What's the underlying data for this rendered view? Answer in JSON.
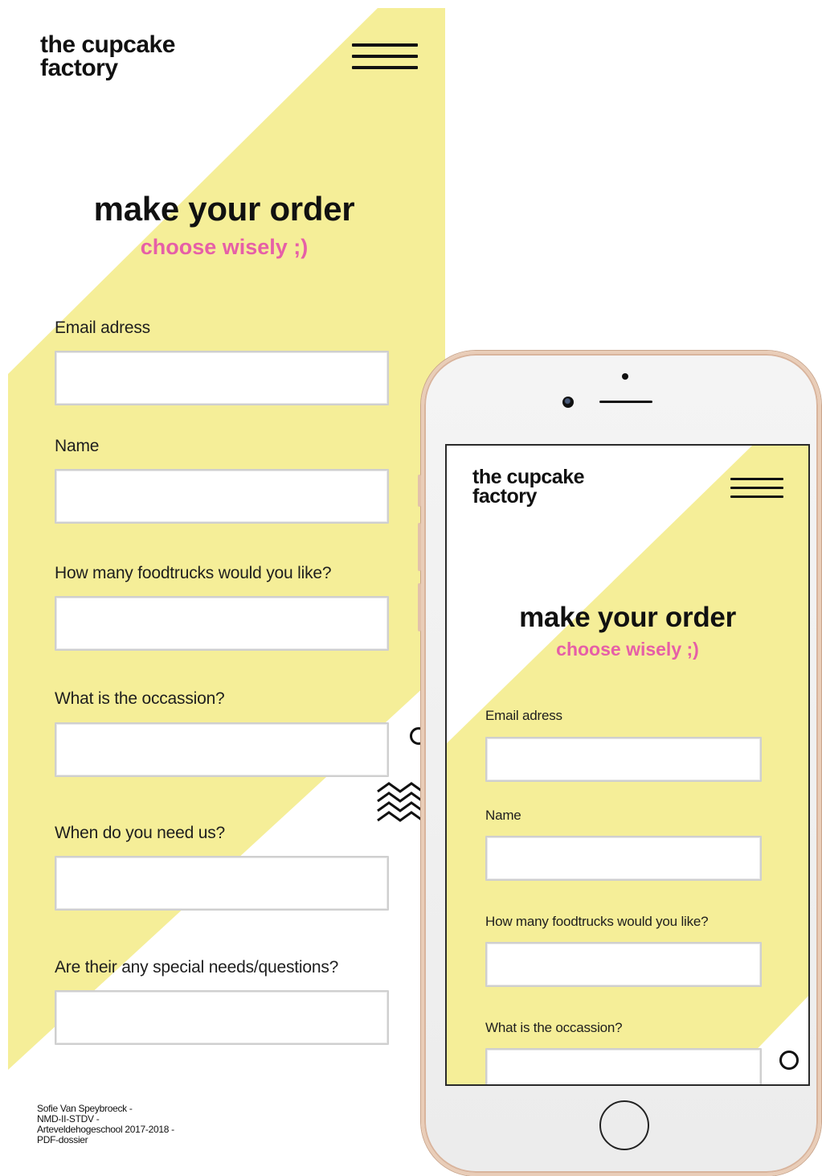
{
  "brand": {
    "line1": "the cupcake",
    "line2": "factory"
  },
  "colors": {
    "yellow": "#f5ee98",
    "pink": "#e65fa7",
    "ink": "#111111"
  },
  "page": {
    "title": "make your order",
    "subtitle": "choose wisely ;)"
  },
  "form": {
    "fields": [
      {
        "label": "Email adress",
        "value": ""
      },
      {
        "label": "Name",
        "value": ""
      },
      {
        "label": "How many foodtrucks would you like?",
        "value": ""
      },
      {
        "label": "What is the occassion?",
        "value": ""
      },
      {
        "label": "When do you need us?",
        "value": ""
      },
      {
        "label": "Are their any special needs/questions?",
        "value": ""
      }
    ]
  },
  "footer": {
    "lines": [
      "Sofie Van Speybroeck -",
      "NMD-II-STDV -",
      "Arteveldehogeschool 2017-2018 -",
      "PDF-dossier"
    ]
  },
  "icons": {
    "menu": "hamburger-icon",
    "ring": "circle-icon",
    "zigzag": "zigzag-icon"
  }
}
